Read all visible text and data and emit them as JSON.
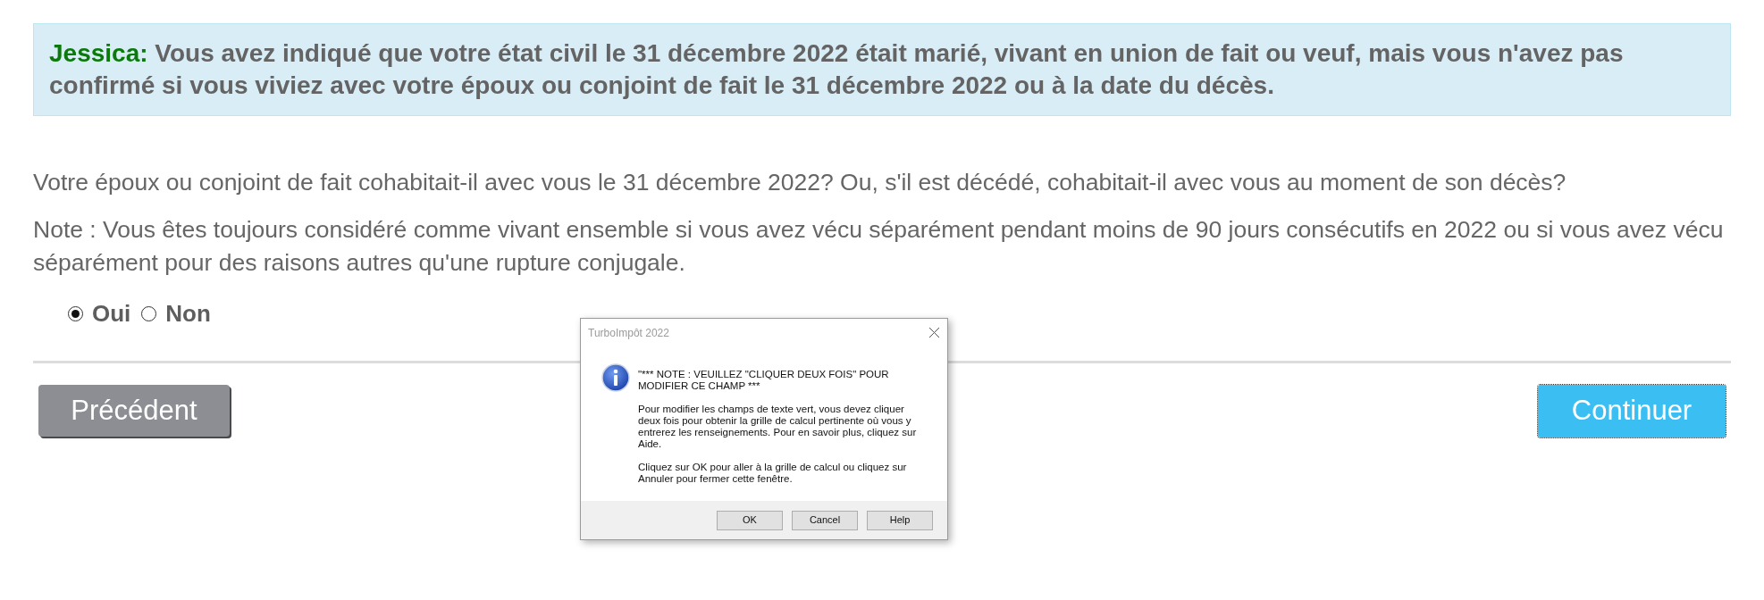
{
  "alert": {
    "name": "Jessica:",
    "text": "Vous avez indiqué que votre état civil le 31 décembre 2022 était marié, vivant en union de fait ou veuf, mais vous n'avez pas confirmé si vous viviez avec votre époux ou conjoint de fait le 31 décembre 2022 ou à la date du décès."
  },
  "question": "Votre époux ou conjoint de fait cohabitait-il avec vous le 31 décembre 2022? Ou, s'il est décédé, cohabitait-il avec vous au moment de son décès?",
  "note": "Note : Vous êtes toujours considéré comme vivant ensemble si vous avez vécu séparément pendant moins de 90 jours consécutifs en 2022 ou si vous avez vécu séparément pour des raisons autres qu'une rupture conjugale.",
  "options": [
    {
      "label": "Oui",
      "selected": true
    },
    {
      "label": "Non",
      "selected": false
    }
  ],
  "nav_buttons": [
    {
      "label": "Précédent",
      "kind": "secondary",
      "focused": false
    },
    {
      "label": "Continuer",
      "kind": "primary",
      "focused": true
    }
  ],
  "dialog": {
    "title": "TurboImpôt 2022",
    "paragraphs": [
      "\"*** NOTE : VEUILLEZ \"CLIQUER DEUX FOIS\" POUR MODIFIER CE CHAMP ***",
      "Pour modifier les champs de texte vert, vous devez cliquer deux fois pour obtenir la grille de calcul pertinente où vous y entrerez les renseignements. Pour en savoir plus, cliquez sur Aide.",
      "Cliquez sur OK pour aller à la grille de calcul ou cliquez sur Annuler pour fermer cette fenêtre."
    ],
    "buttons": [
      "OK",
      "Cancel",
      "Help"
    ]
  }
}
